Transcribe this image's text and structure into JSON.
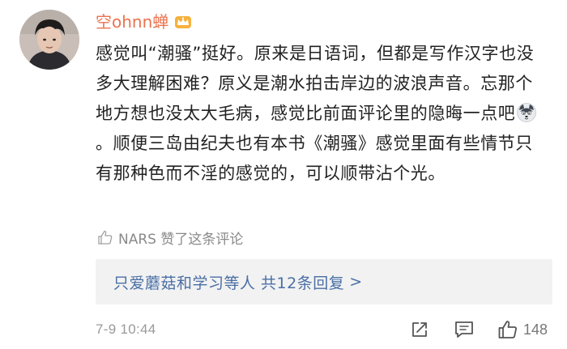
{
  "comment": {
    "username": "空ohnn蝉",
    "text_part1": "感觉叫“潮骚”挺好。原来是日语词，但都是写作汉字也没多大理解困难？原义是潮水拍击岸边的波浪声音。忘那个地方想也没太大毛病，感觉比前面评论里的隐晦一点吧",
    "text_part2": "。顺便三岛由纪夫也有本书《潮骚》感觉里面有些情节只有那种色而不淫的感觉的，可以顺带沾个光。",
    "emoji": "husky-emoji",
    "badge": "crown-icon",
    "liked_by": "NARS 赞了这条评论",
    "replies_summary": "只爱蘑菇和学习等人  共12条回复",
    "replies_chevron": ">",
    "timestamp": "7-9 10:44",
    "like_count": "148"
  },
  "colors": {
    "username": "#eb7350",
    "link": "#4a6fa5",
    "muted": "#8a8a8a",
    "text": "#222222",
    "reply_bg": "#f2f2f2"
  }
}
